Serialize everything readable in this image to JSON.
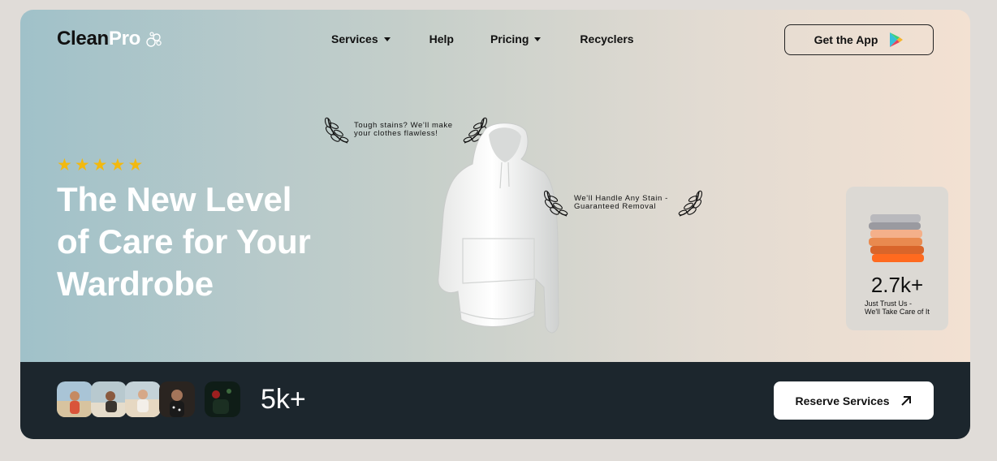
{
  "brand": {
    "name_part1": "Clean",
    "name_part2": "Pro",
    "icon": "bubbles-icon"
  },
  "nav": {
    "items": [
      {
        "label": "Services",
        "has_dropdown": true
      },
      {
        "label": "Help",
        "has_dropdown": false
      },
      {
        "label": "Pricing",
        "has_dropdown": true
      },
      {
        "label": "Recyclers",
        "has_dropdown": false
      }
    ],
    "cta_label": "Get the App",
    "cta_icon": "google-play-icon"
  },
  "hero": {
    "rating_stars": 5,
    "headline": "The New Level of Care for Your Wardrobe",
    "badge1": "Tough stains? We'll make your clothes flawless!",
    "badge2": "We'll Handle Any Stain - Guaranteed Removal"
  },
  "stats": {
    "value": "2.7k+",
    "caption_line1": "Just Trust Us -",
    "caption_line2": "We'll Take Care of It"
  },
  "footer": {
    "customers_count": "5k+",
    "reserve_label": "Reserve Services",
    "reserve_icon": "arrow-up-right-icon"
  },
  "colors": {
    "accent_star": "#f2b90f",
    "dark_bar": "#1c262d",
    "gradient_left": "#a0c1c9",
    "gradient_right": "#f3e1d2"
  }
}
